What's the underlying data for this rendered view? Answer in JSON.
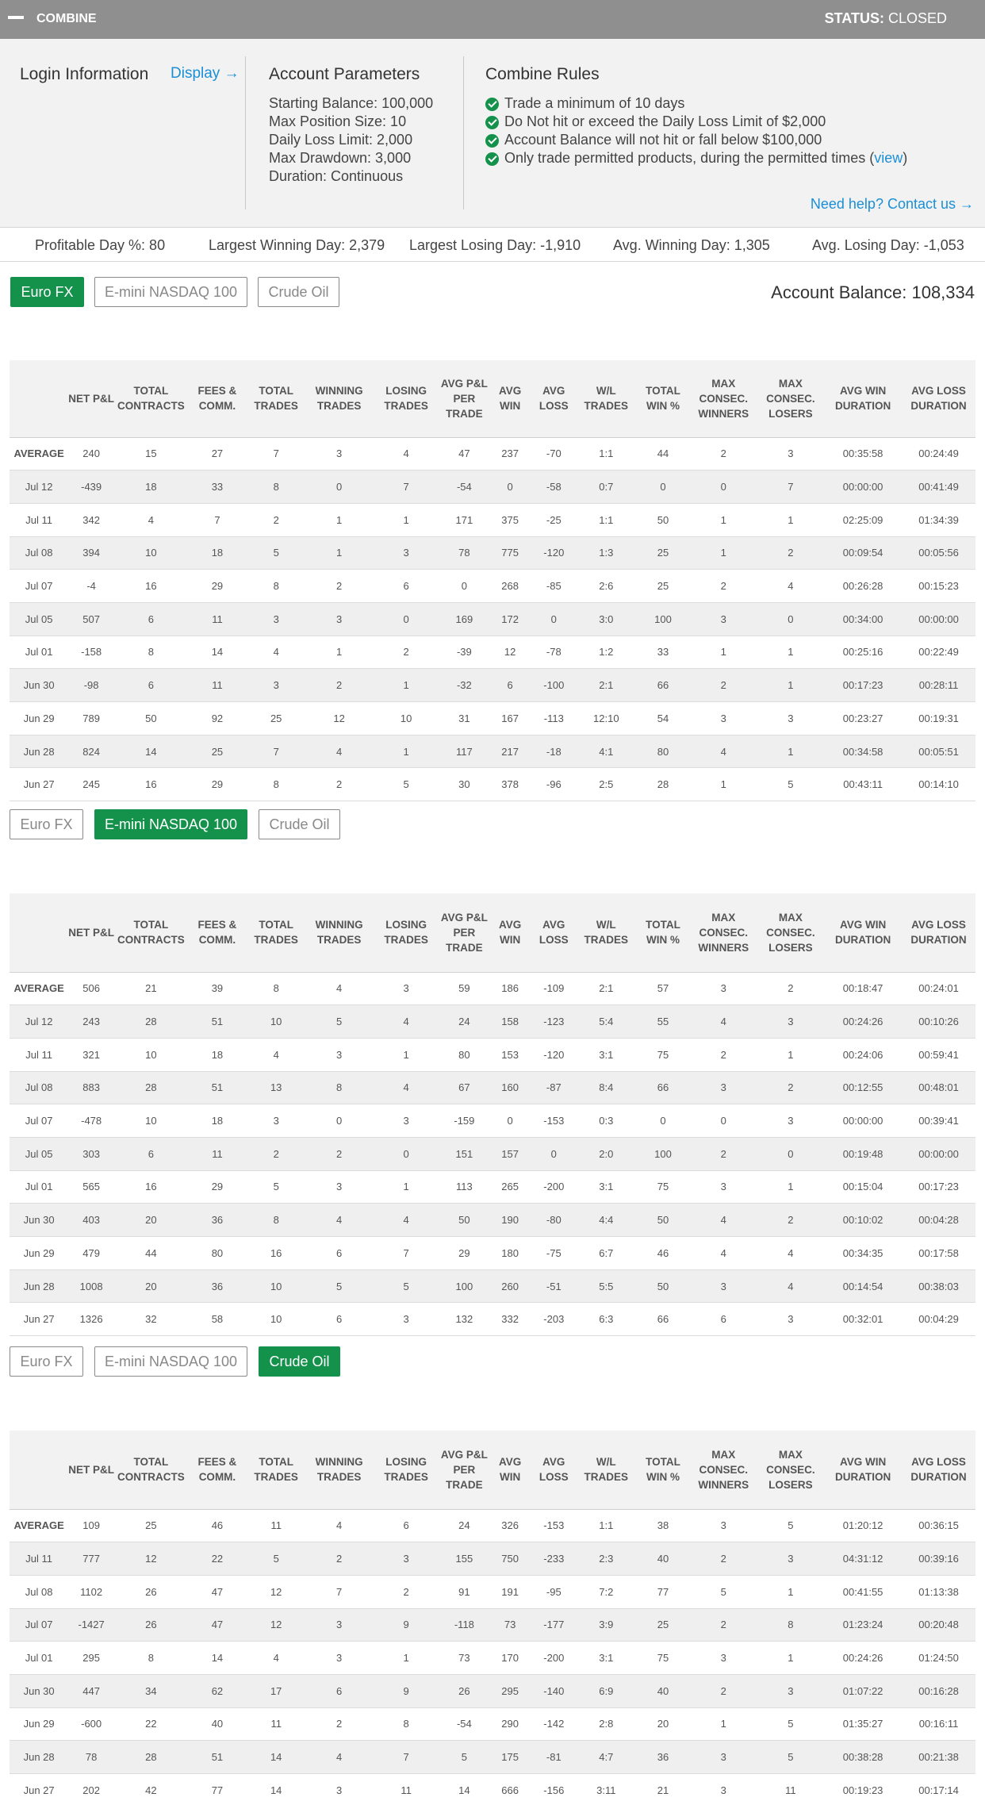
{
  "topbar": {
    "title": "COMBINE",
    "status_label": "STATUS:",
    "status_value": "CLOSED"
  },
  "login": {
    "title": "Login Information",
    "display_link": "Display →"
  },
  "params": {
    "title": "Account Parameters",
    "items": [
      "Starting Balance: 100,000",
      "Max Position Size: 10",
      "Daily Loss Limit: 2,000",
      "Max Drawdown: 3,000",
      "Duration: Continuous"
    ]
  },
  "rules": {
    "title": "Combine Rules",
    "items": [
      "Trade a minimum of 10 days",
      "Do Not hit or exceed the Daily Loss Limit of $2,000",
      "Account Balance will not hit or fall below $100,000",
      "Only trade permitted products, during the permitted times ("
    ],
    "view_link": "view",
    "view_close": ")",
    "help_link": "Need help? Contact us →"
  },
  "summary": [
    "Profitable Day %: 80",
    "Largest Winning Day: 2,379",
    "Largest Losing Day: -1,910",
    "Avg. Winning Day: 1,305",
    "Avg. Losing Day: -1,053"
  ],
  "products": [
    "Euro FX",
    "E-mini NASDAQ 100",
    "Crude Oil"
  ],
  "account_balance": "Account Balance: 108,334",
  "columns": [
    "",
    "NET P&L",
    "TOTAL CONTRACTS",
    "FEES & COMM.",
    "TOTAL TRADES",
    "WINNING TRADES",
    "LOSING TRADES",
    "AVG P&L PER TRADE",
    "AVG WIN",
    "AVG LOSS",
    "W/L TRADES",
    "TOTAL WIN %",
    "MAX CONSEC. WINNERS",
    "MAX CONSEC. LOSERS",
    "AVG WIN DURATION",
    "AVG LOSS DURATION"
  ],
  "tables": [
    {
      "product": "Euro FX",
      "rows": [
        [
          "AVERAGE",
          "240",
          "15",
          "27",
          "7",
          "3",
          "4",
          "47",
          "237",
          "-70",
          "1:1",
          "44",
          "2",
          "3",
          "00:35:58",
          "00:24:49"
        ],
        [
          "Jul 12",
          "-439",
          "18",
          "33",
          "8",
          "0",
          "7",
          "-54",
          "0",
          "-58",
          "0:7",
          "0",
          "0",
          "7",
          "00:00:00",
          "00:41:49"
        ],
        [
          "Jul 11",
          "342",
          "4",
          "7",
          "2",
          "1",
          "1",
          "171",
          "375",
          "-25",
          "1:1",
          "50",
          "1",
          "1",
          "02:25:09",
          "01:34:39"
        ],
        [
          "Jul 08",
          "394",
          "10",
          "18",
          "5",
          "1",
          "3",
          "78",
          "775",
          "-120",
          "1:3",
          "25",
          "1",
          "2",
          "00:09:54",
          "00:05:56"
        ],
        [
          "Jul 07",
          "-4",
          "16",
          "29",
          "8",
          "2",
          "6",
          "0",
          "268",
          "-85",
          "2:6",
          "25",
          "2",
          "4",
          "00:26:28",
          "00:15:23"
        ],
        [
          "Jul 05",
          "507",
          "6",
          "11",
          "3",
          "3",
          "0",
          "169",
          "172",
          "0",
          "3:0",
          "100",
          "3",
          "0",
          "00:34:00",
          "00:00:00"
        ],
        [
          "Jul 01",
          "-158",
          "8",
          "14",
          "4",
          "1",
          "2",
          "-39",
          "12",
          "-78",
          "1:2",
          "33",
          "1",
          "1",
          "00:25:16",
          "00:22:49"
        ],
        [
          "Jun 30",
          "-98",
          "6",
          "11",
          "3",
          "2",
          "1",
          "-32",
          "6",
          "-100",
          "2:1",
          "66",
          "2",
          "1",
          "00:17:23",
          "00:28:11"
        ],
        [
          "Jun 29",
          "789",
          "50",
          "92",
          "25",
          "12",
          "10",
          "31",
          "167",
          "-113",
          "12:10",
          "54",
          "3",
          "3",
          "00:23:27",
          "00:19:31"
        ],
        [
          "Jun 28",
          "824",
          "14",
          "25",
          "7",
          "4",
          "1",
          "117",
          "217",
          "-18",
          "4:1",
          "80",
          "4",
          "1",
          "00:34:58",
          "00:05:51"
        ],
        [
          "Jun 27",
          "245",
          "16",
          "29",
          "8",
          "2",
          "5",
          "30",
          "378",
          "-96",
          "2:5",
          "28",
          "1",
          "5",
          "00:43:11",
          "00:14:10"
        ]
      ]
    },
    {
      "product": "E-mini NASDAQ 100",
      "rows": [
        [
          "AVERAGE",
          "506",
          "21",
          "39",
          "8",
          "4",
          "3",
          "59",
          "186",
          "-109",
          "2:1",
          "57",
          "3",
          "2",
          "00:18:47",
          "00:24:01"
        ],
        [
          "Jul 12",
          "243",
          "28",
          "51",
          "10",
          "5",
          "4",
          "24",
          "158",
          "-123",
          "5:4",
          "55",
          "4",
          "3",
          "00:24:26",
          "00:10:26"
        ],
        [
          "Jul 11",
          "321",
          "10",
          "18",
          "4",
          "3",
          "1",
          "80",
          "153",
          "-120",
          "3:1",
          "75",
          "2",
          "1",
          "00:24:06",
          "00:59:41"
        ],
        [
          "Jul 08",
          "883",
          "28",
          "51",
          "13",
          "8",
          "4",
          "67",
          "160",
          "-87",
          "8:4",
          "66",
          "3",
          "2",
          "00:12:55",
          "00:48:01"
        ],
        [
          "Jul 07",
          "-478",
          "10",
          "18",
          "3",
          "0",
          "3",
          "-159",
          "0",
          "-153",
          "0:3",
          "0",
          "0",
          "3",
          "00:00:00",
          "00:39:41"
        ],
        [
          "Jul 05",
          "303",
          "6",
          "11",
          "2",
          "2",
          "0",
          "151",
          "157",
          "0",
          "2:0",
          "100",
          "2",
          "0",
          "00:19:48",
          "00:00:00"
        ],
        [
          "Jul 01",
          "565",
          "16",
          "29",
          "5",
          "3",
          "1",
          "113",
          "265",
          "-200",
          "3:1",
          "75",
          "3",
          "1",
          "00:15:04",
          "00:17:23"
        ],
        [
          "Jun 30",
          "403",
          "20",
          "36",
          "8",
          "4",
          "4",
          "50",
          "190",
          "-80",
          "4:4",
          "50",
          "4",
          "2",
          "00:10:02",
          "00:04:28"
        ],
        [
          "Jun 29",
          "479",
          "44",
          "80",
          "16",
          "6",
          "7",
          "29",
          "180",
          "-75",
          "6:7",
          "46",
          "4",
          "4",
          "00:34:35",
          "00:17:58"
        ],
        [
          "Jun 28",
          "1008",
          "20",
          "36",
          "10",
          "5",
          "5",
          "100",
          "260",
          "-51",
          "5:5",
          "50",
          "3",
          "4",
          "00:14:54",
          "00:38:03"
        ],
        [
          "Jun 27",
          "1326",
          "32",
          "58",
          "10",
          "6",
          "3",
          "132",
          "332",
          "-203",
          "6:3",
          "66",
          "6",
          "3",
          "00:32:01",
          "00:04:29"
        ]
      ]
    },
    {
      "product": "Crude Oil",
      "rows": [
        [
          "AVERAGE",
          "109",
          "25",
          "46",
          "11",
          "4",
          "6",
          "24",
          "326",
          "-153",
          "1:1",
          "38",
          "3",
          "5",
          "01:20:12",
          "00:36:15"
        ],
        [
          "Jul 11",
          "777",
          "12",
          "22",
          "5",
          "2",
          "3",
          "155",
          "750",
          "-233",
          "2:3",
          "40",
          "2",
          "3",
          "04:31:12",
          "00:39:16"
        ],
        [
          "Jul 08",
          "1102",
          "26",
          "47",
          "12",
          "7",
          "2",
          "91",
          "191",
          "-95",
          "7:2",
          "77",
          "5",
          "1",
          "00:41:55",
          "01:13:38"
        ],
        [
          "Jul 07",
          "-1427",
          "26",
          "47",
          "12",
          "3",
          "9",
          "-118",
          "73",
          "-177",
          "3:9",
          "25",
          "2",
          "8",
          "01:23:24",
          "00:20:48"
        ],
        [
          "Jul 01",
          "295",
          "8",
          "14",
          "4",
          "3",
          "1",
          "73",
          "170",
          "-200",
          "3:1",
          "75",
          "3",
          "1",
          "00:24:26",
          "01:24:50"
        ],
        [
          "Jun 30",
          "447",
          "34",
          "62",
          "17",
          "6",
          "9",
          "26",
          "295",
          "-140",
          "6:9",
          "40",
          "2",
          "3",
          "01:07:22",
          "00:16:28"
        ],
        [
          "Jun 29",
          "-600",
          "22",
          "40",
          "11",
          "2",
          "8",
          "-54",
          "290",
          "-142",
          "2:8",
          "20",
          "1",
          "5",
          "01:35:27",
          "00:16:11"
        ],
        [
          "Jun 28",
          "78",
          "28",
          "51",
          "14",
          "4",
          "7",
          "5",
          "175",
          "-81",
          "4:7",
          "36",
          "3",
          "5",
          "00:38:28",
          "00:21:38"
        ],
        [
          "Jun 27",
          "202",
          "42",
          "77",
          "14",
          "3",
          "11",
          "14",
          "666",
          "-156",
          "3:11",
          "21",
          "3",
          "11",
          "00:19:23",
          "00:17:14"
        ]
      ]
    }
  ]
}
